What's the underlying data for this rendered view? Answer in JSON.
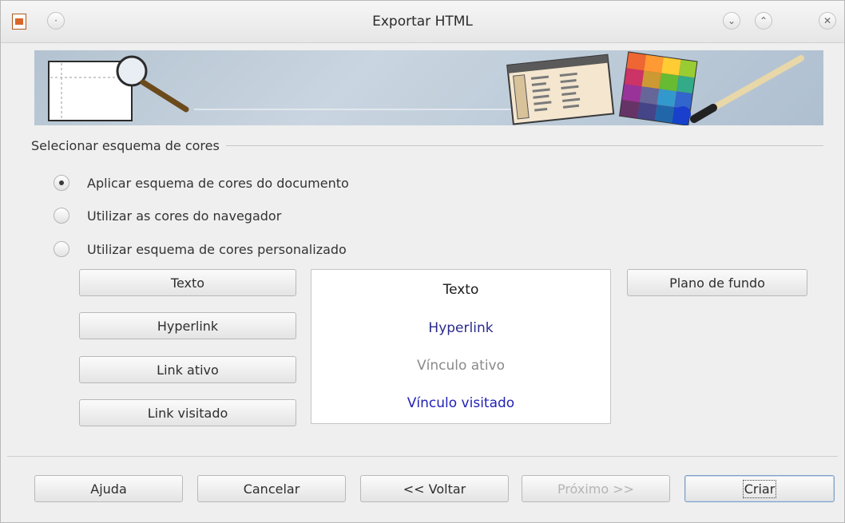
{
  "window": {
    "title": "Exportar HTML"
  },
  "section": {
    "label": "Selecionar esquema de cores"
  },
  "radios": [
    {
      "label": "Aplicar esquema de cores do documento",
      "checked": true
    },
    {
      "label": "Utilizar as cores do navegador",
      "checked": false
    },
    {
      "label": "Utilizar esquema de cores personalizado",
      "checked": false
    }
  ],
  "color_buttons": {
    "text": "Texto",
    "hyperlink": "Hyperlink",
    "active_link": "Link ativo",
    "visited_link": "Link visitado",
    "background": "Plano de fundo"
  },
  "preview": {
    "text": "Texto",
    "hyperlink": "Hyperlink",
    "active_link": "Vínculo ativo",
    "visited_link": "Vínculo visitado",
    "colors": {
      "text": "#1a1a1a",
      "hyperlink": "#2a2a8c",
      "active_link": "#8a8a8a",
      "visited_link": "#2222b8"
    }
  },
  "footer": {
    "help": "Ajuda",
    "cancel": "Cancelar",
    "back": "<< Voltar",
    "next": "Próximo >>",
    "create": "Criar"
  },
  "icons": [
    "app-icon",
    "pin-icon",
    "minimize-icon",
    "maximize-icon",
    "close-icon"
  ]
}
